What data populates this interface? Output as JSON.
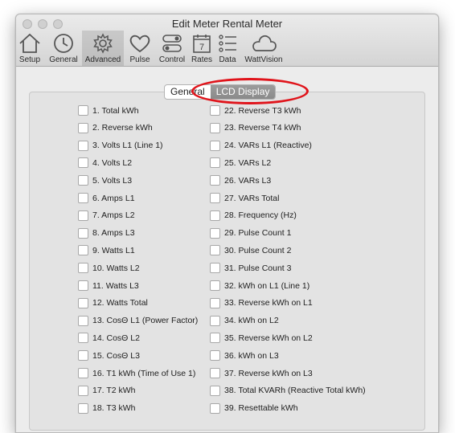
{
  "window": {
    "title": "Edit Meter Rental Meter"
  },
  "toolbar": {
    "items": [
      {
        "label": "Setup",
        "icon": "house-icon"
      },
      {
        "label": "General",
        "icon": "clock-icon"
      },
      {
        "label": "Advanced",
        "icon": "gear-icon"
      },
      {
        "label": "Pulse",
        "icon": "heart-icon"
      },
      {
        "label": "Control",
        "icon": "toggles-icon"
      },
      {
        "label": "Rates",
        "icon": "calendar-icon",
        "badge": "7"
      },
      {
        "label": "Data",
        "icon": "list-icon"
      },
      {
        "label": "WattVision",
        "icon": "cloud-icon"
      }
    ],
    "active": "Advanced"
  },
  "tabs": {
    "general": "General",
    "lcd": "LCD Display",
    "selected": "LCD Display"
  },
  "left": [
    "1. Total kWh",
    "2. Reverse kWh",
    "3. Volts L1 (Line 1)",
    "4. Volts L2",
    "5. Volts L3",
    "6. Amps L1",
    "7. Amps L2",
    "8. Amps L3",
    "9. Watts L1",
    "10. Watts L2",
    "11. Watts L3",
    "12. Watts Total",
    "13. CosΘ L1 (Power Factor)",
    "14. CosΘ L2",
    "15. CosΘ L3",
    "16. T1 kWh (Time of Use 1)",
    "17. T2 kWh",
    "18. T3 kWh"
  ],
  "right": [
    "22. Reverse T3 kWh",
    "23. Reverse T4 kWh",
    "24. VARs L1 (Reactive)",
    "25. VARs L2",
    "26. VARs L3",
    "27. VARs Total",
    "28. Frequency (Hz)",
    "29. Pulse Count 1",
    "30. Pulse Count 2",
    "31. Pulse Count 3",
    "32. kWh on L1 (Line 1)",
    "33. Reverse kWh on L1",
    "34. kWh on L2",
    "35. Reverse kWh on L2",
    "36. kWh on L3",
    "37. Reverse kWh on L3",
    "38. Total KVARh (Reactive Total kWh)",
    "39. Resettable kWh"
  ],
  "colors": {
    "highlight": "#e0141b",
    "selected_segment": "#8f8f8f"
  }
}
